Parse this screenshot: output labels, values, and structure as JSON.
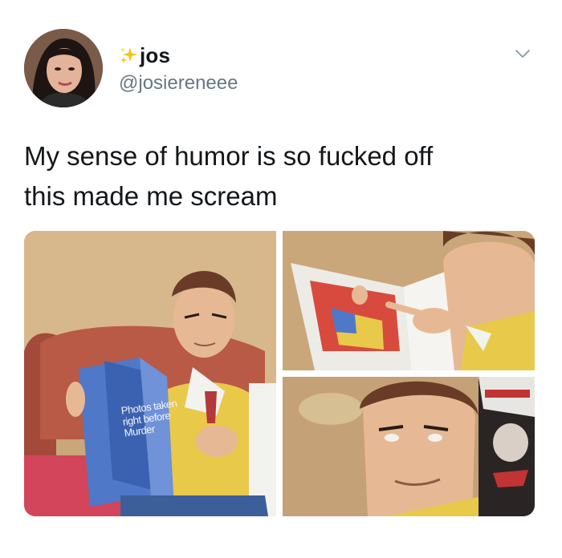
{
  "tweet": {
    "display_name": "jos",
    "handle": "@josiereneee",
    "text_lines": [
      "My sense of humor is so fucked off",
      "this made me scream"
    ]
  },
  "icons": {
    "name_prefix": "sparkles-icon",
    "menu": "chevron-down-icon"
  },
  "media": {
    "book_text_lines": [
      "Photos taken",
      "right before",
      "Murder"
    ]
  },
  "colors": {
    "text": "#14171a",
    "secondary": "#657786",
    "sparkle": "#f5c518",
    "book_blue": "#4f78c8",
    "sweater_yellow": "#e9c94a"
  }
}
